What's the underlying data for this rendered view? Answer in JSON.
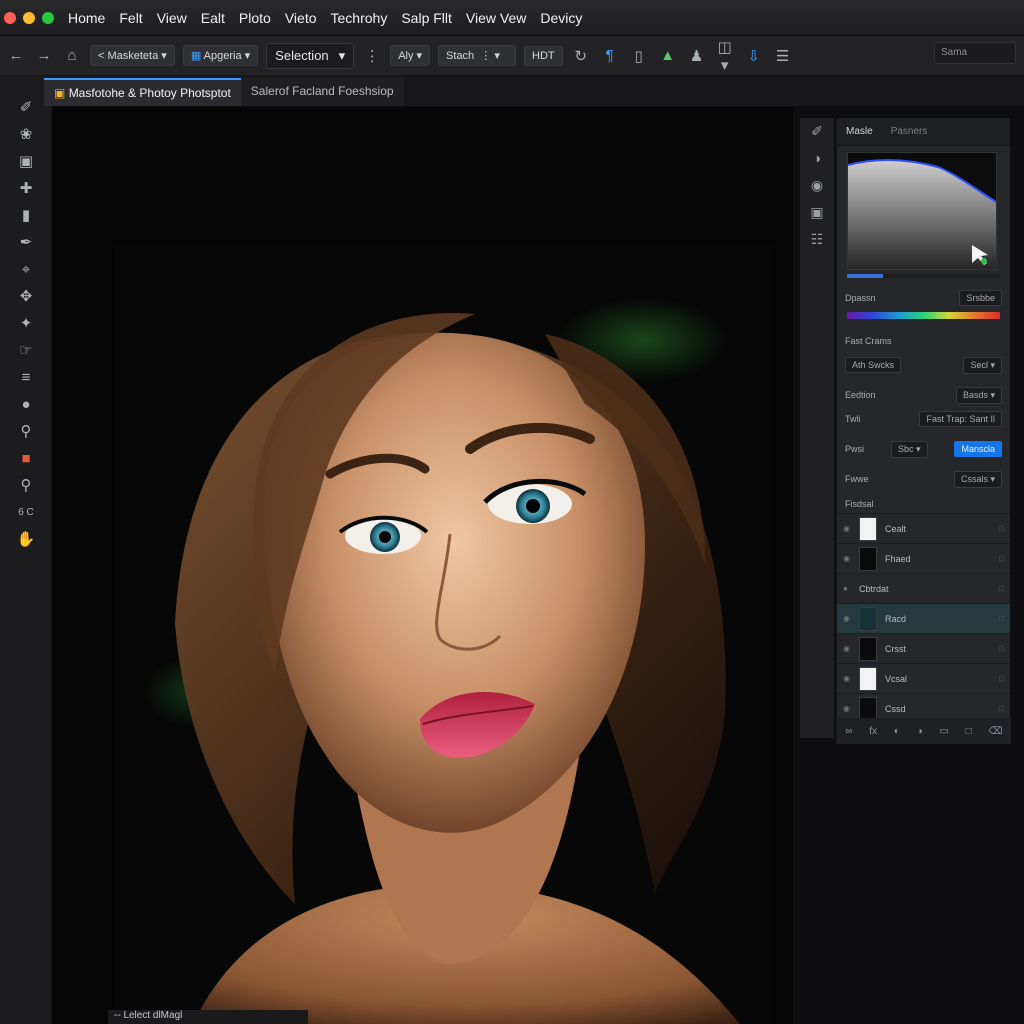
{
  "menubar": {
    "traffic_colors": [
      "#ff5f57",
      "#febc2e",
      "#28c840"
    ],
    "items": [
      "Home",
      "Felt",
      "View",
      "Ealt",
      "Ploto",
      "Vieto",
      "Techrohy",
      "Salp Fllt",
      "View Vew",
      "Devicy"
    ]
  },
  "options": {
    "back_icon": "back-arrow-icon",
    "forward_icon": "forward-arrow-icon",
    "home_icon": "home-icon",
    "preset_label": "< Masketeta",
    "grid_label": "Apgeria",
    "selection_label": "Selection",
    "align_label": "Aly",
    "stack_label": "Stach",
    "hdt_label": "HDT",
    "search_placeholder": "Sama"
  },
  "tabs": [
    {
      "label": "Masfotohe & Photoy Photsptot",
      "active": true
    },
    {
      "label": "Salerof Facland Foeshsiop",
      "active": false
    }
  ],
  "tools": {
    "items": [
      "brush-icon",
      "lasso-icon",
      "stamp-icon",
      "heal-icon",
      "eraser-icon",
      "pen-icon",
      "crop-icon",
      "move-icon",
      "wand-icon",
      "smudge-icon",
      "text-icon",
      "dodge-icon",
      "zoom-icon",
      "color-swatch-icon",
      "magnify-icon",
      "hand-icon"
    ],
    "size_label": "6 C",
    "accent_color": "#e8563c"
  },
  "canvas": {
    "bottom_caption": "-- Lelect dlMagl"
  },
  "panel": {
    "tab_active": "Masle",
    "tab_inactive": "Pasners",
    "histogram_curve_color": "#2f4fff",
    "label_1": "Dpassn",
    "value_1": "Srsbbe",
    "section_fast": "Fast Crams",
    "auto_label": "Ath Swcks",
    "select_label": "Secl",
    "section_edit": "Eedtion",
    "edit_value": "Basds",
    "tool_label": "Twli",
    "tool_value": "Fast Trap: Sant Il",
    "mode_label": "Pwsi",
    "mode_value": "Sbc",
    "apply_label": "Manscla",
    "group_label": "Fwwe",
    "group_value": "Cssals",
    "layers_section": "Fisdsal",
    "layers": [
      {
        "name": "Cealt",
        "thumb": "white",
        "sel": false
      },
      {
        "name": "Fhaed",
        "thumb": "none",
        "sel": false
      },
      {
        "name": "Cbtrdat",
        "thumb": "circle",
        "sel": false
      },
      {
        "name": "Racd",
        "thumb": "teal",
        "sel": true
      },
      {
        "name": "Crsst",
        "thumb": "dark",
        "sel": false
      },
      {
        "name": "Vcsal",
        "thumb": "white",
        "sel": false
      },
      {
        "name": "Cssd",
        "thumb": "dark",
        "sel": false
      }
    ],
    "accent_color": "#1476e8"
  }
}
